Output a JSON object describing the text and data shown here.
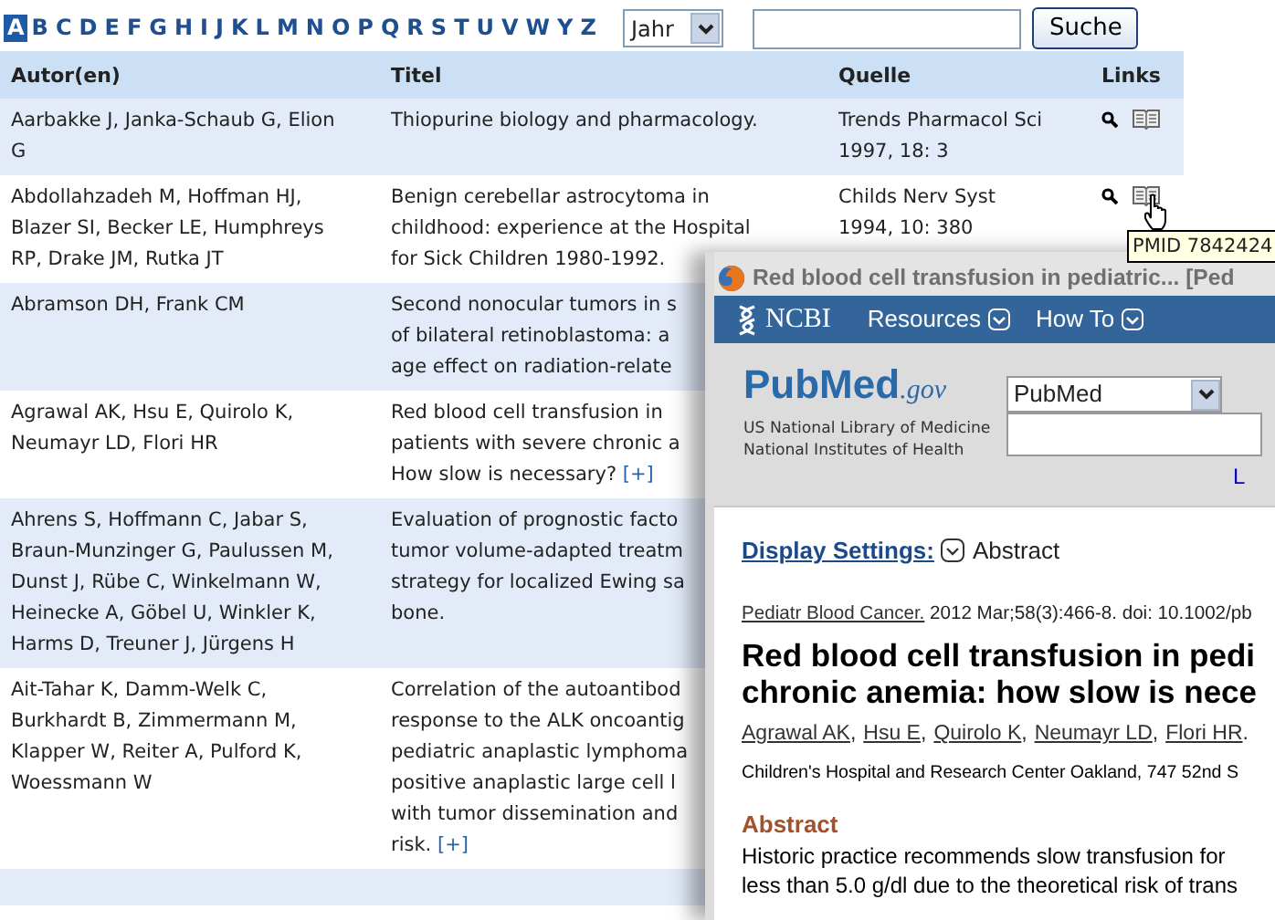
{
  "alphabet": [
    {
      "letter": "A",
      "selected": true
    },
    {
      "letter": "B",
      "selected": false
    },
    {
      "letter": "C",
      "selected": false
    },
    {
      "letter": "D",
      "selected": false
    },
    {
      "letter": "E",
      "selected": false
    },
    {
      "letter": "F",
      "selected": false
    },
    {
      "letter": "G",
      "selected": false
    },
    {
      "letter": "H",
      "selected": false
    },
    {
      "letter": "I",
      "selected": false
    },
    {
      "letter": "J",
      "selected": false
    },
    {
      "letter": "K",
      "selected": false
    },
    {
      "letter": "L",
      "selected": false
    },
    {
      "letter": "M",
      "selected": false
    },
    {
      "letter": "N",
      "selected": false
    },
    {
      "letter": "O",
      "selected": false
    },
    {
      "letter": "P",
      "selected": false
    },
    {
      "letter": "Q",
      "selected": false
    },
    {
      "letter": "R",
      "selected": false
    },
    {
      "letter": "S",
      "selected": false
    },
    {
      "letter": "T",
      "selected": false
    },
    {
      "letter": "U",
      "selected": false
    },
    {
      "letter": "V",
      "selected": false
    },
    {
      "letter": "W",
      "selected": false
    },
    {
      "letter": "Y",
      "selected": false
    },
    {
      "letter": "Z",
      "selected": false
    }
  ],
  "year_select": {
    "value": "Jahr"
  },
  "search": {
    "button": "Suche"
  },
  "table": {
    "columns": [
      "Autor(en)",
      "Titel",
      "Quelle",
      "Links"
    ],
    "rows": [
      {
        "author_lines": [
          "Aarbakke J, Janka-Schaub G, Elion",
          "G"
        ],
        "title_lines": [
          "Thiopurine biology and pharmacology."
        ],
        "source_lines": [
          "Trends Pharmacol Sci",
          "1997, 18: 3"
        ],
        "links": [
          {
            "kind": "search"
          },
          {
            "kind": "book"
          }
        ]
      },
      {
        "author_lines": [
          "Abdollahzadeh M, Hoffman HJ,",
          "Blazer SI, Becker LE, Humphreys",
          "RP, Drake JM, Rutka JT"
        ],
        "title_lines": [
          "Benign cerebellar astrocytoma in",
          "childhood: experience at the Hospital",
          "for Sick Children 1980-1992."
        ],
        "source_lines": [
          "Childs Nerv Syst",
          "1994, 10: 380"
        ],
        "links": [
          {
            "kind": "search"
          },
          {
            "kind": "book"
          }
        ]
      },
      {
        "author_lines": [
          "Abramson DH, Frank CM"
        ],
        "title_lines": [
          "Second nonocular tumors in s",
          "of bilateral retinoblastoma: a",
          "age effect on radiation-relate"
        ]
      },
      {
        "author_lines": [
          "Agrawal AK, Hsu E, Quirolo K,",
          "Neumayr LD, Flori HR"
        ],
        "title_lines": [
          "Red blood cell transfusion in",
          "patients with severe chronic a",
          "How slow is necessary?"
        ],
        "more_link": "[+]"
      },
      {
        "author_lines": [
          "Ahrens S, Hoffmann C, Jabar S,",
          "Braun-Munzinger G, Paulussen M,",
          "Dunst J, Rübe C, Winkelmann W,",
          "Heinecke A, Göbel U, Winkler K,",
          "Harms D, Treuner J, Jürgens H"
        ],
        "title_lines": [
          "Evaluation of prognostic facto",
          "tumor volume-adapted treatm",
          "strategy for localized Ewing sa",
          "bone."
        ]
      },
      {
        "author_lines": [
          "Ait-Tahar K, Damm-Welk C,",
          "Burkhardt B, Zimmermann M,",
          "Klapper W, Reiter A, Pulford K,",
          "Woessmann W"
        ],
        "title_lines": [
          "Correlation of the autoantibod",
          "response to the ALK oncoantig",
          "pediatric anaplastic lymphoma",
          "positive anaplastic large cell l",
          "with tumor dissemination and",
          "risk."
        ],
        "more_link": "[+]"
      }
    ]
  },
  "tooltip": {
    "text": "PMID 7842424"
  },
  "popup": {
    "title": "Red blood cell transfusion in pediatric... [Ped",
    "ncbi": {
      "logo": "NCBI",
      "menus": [
        "Resources",
        "How To"
      ]
    },
    "pubmed": {
      "logo": "PubMed",
      "logo_suffix": ".gov",
      "library": "US National Library of Medicine National Institutes of Health",
      "database": "PubMed",
      "link": "L"
    },
    "display_settings": {
      "label": "Display Settings:",
      "value": "Abstract"
    },
    "citation": {
      "journal": "Pediatr Blood Cancer.",
      "details": " 2012 Mar;58(3):466-8. doi: 10.1002/pb"
    },
    "article_title_lines": [
      "Red blood cell transfusion in pedi",
      "chronic anemia: how slow is nece"
    ],
    "authors": [
      {
        "name": "Agrawal AK",
        "after": ","
      },
      {
        "name": "Hsu E",
        "after": ","
      },
      {
        "name": "Quirolo K",
        "after": ","
      },
      {
        "name": "Neumayr LD",
        "after": ","
      },
      {
        "name": "Flori HR",
        "after": "."
      }
    ],
    "affiliation": "Children's Hospital and Research Center Oakland, 747 52nd S",
    "abstract_heading": "Abstract",
    "abstract_lines": [
      "Historic practice recommends slow transfusion for",
      "less than 5.0 g/dl due to the theoretical risk of trans"
    ]
  }
}
